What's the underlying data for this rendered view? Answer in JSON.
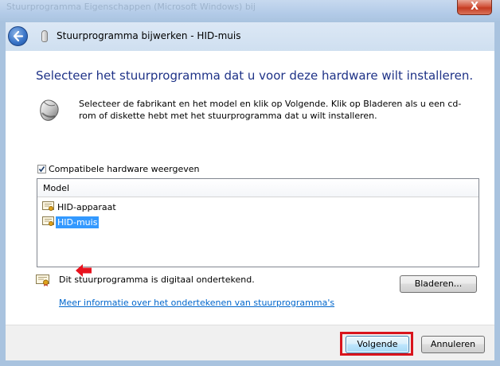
{
  "window": {
    "background_tab_text": "Stuurprogramma Eigenschappen (Microsoft Windows) bij",
    "close_label": "X"
  },
  "nav": {
    "title": "Stuurprogramma bijwerken - HID-muis"
  },
  "main": {
    "heading": "Selecteer het stuurprogramma dat u voor deze hardware wilt installeren.",
    "instructions": "Selecteer de fabrikant en het model en klik op Volgende. Klik op Bladeren als u een cd-rom of diskette hebt met het stuurprogramma dat u wilt installeren.",
    "compatible_checkbox": {
      "label": "Compatibele hardware weergeven",
      "checked": true
    },
    "model_list": {
      "header": "Model",
      "items": [
        {
          "label": "HID-apparaat",
          "selected": false
        },
        {
          "label": "HID-muis",
          "selected": true
        }
      ]
    },
    "signed_text": "Dit stuurprogramma is digitaal ondertekend.",
    "browse_button": "Bladeren...",
    "info_link": "Meer informatie over het ondertekenen van stuurprogramma's"
  },
  "footer": {
    "next_button": "Volgende",
    "cancel_button": "Annuleren"
  },
  "colors": {
    "heading": "#1e3287",
    "selection": "#3399ff",
    "highlight": "#d9141c",
    "link": "#0066cc"
  }
}
